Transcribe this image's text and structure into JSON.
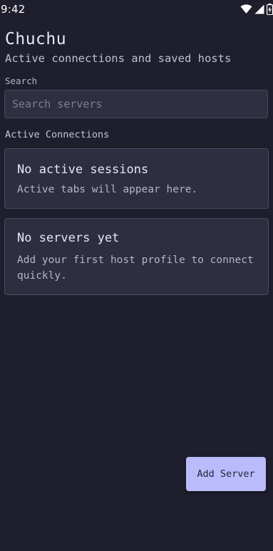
{
  "status_bar": {
    "time": "9:42",
    "icons": [
      "wifi-icon",
      "cell-signal-icon",
      "battery-charging-icon"
    ]
  },
  "header": {
    "title": "Chuchu",
    "subtitle": "Active connections and saved hosts"
  },
  "search": {
    "label": "Search",
    "placeholder": "Search servers",
    "value": ""
  },
  "active_connections": {
    "section_label": "Active Connections",
    "empty_title": "No active sessions",
    "empty_body": "Active tabs will appear here."
  },
  "servers": {
    "empty_title": "No servers yet",
    "empty_body": "Add your first host profile to connect quickly."
  },
  "actions": {
    "add_server_label": "Add Server"
  },
  "colors": {
    "background": "#1e1e2c",
    "card": "#2d2e40",
    "accent": "#b9bbfb"
  }
}
